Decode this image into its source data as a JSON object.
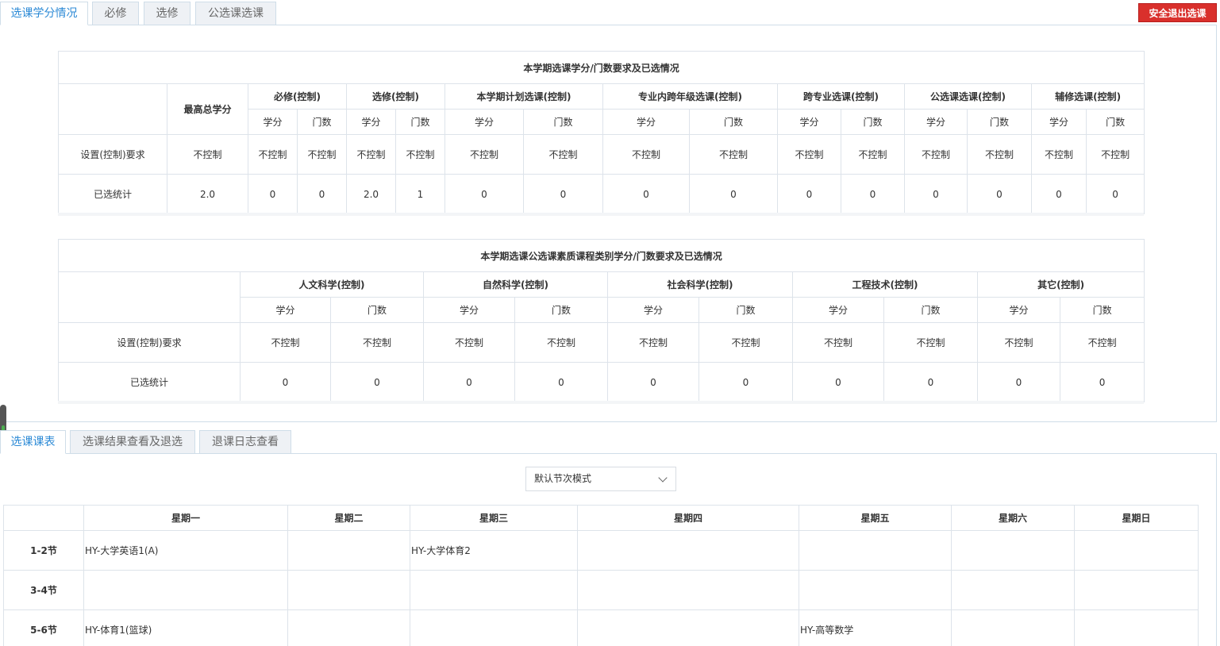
{
  "top_tabs": [
    "选课学分情况",
    "必修",
    "选修",
    "公选课选课"
  ],
  "exit_button": "安全退出选课",
  "credit_table": {
    "title": "本学期选课学分/门数要求及已选情况",
    "max_total_label": "最高总学分",
    "groups": [
      "必修(控制)",
      "选修(控制)",
      "本学期计划选课(控制)",
      "专业内跨年级选课(控制)",
      "跨专业选课(控制)",
      "公选课选课(控制)",
      "辅修选课(控制)"
    ],
    "sub_credit": "学分",
    "sub_count": "门数",
    "rows": [
      {
        "label": "设置(控制)要求",
        "max": "不控制",
        "values": [
          "不控制",
          "不控制",
          "不控制",
          "不控制",
          "不控制",
          "不控制",
          "不控制",
          "不控制",
          "不控制",
          "不控制",
          "不控制",
          "不控制",
          "不控制",
          "不控制"
        ]
      },
      {
        "label": "已选统计",
        "max": "2.0",
        "values": [
          "0",
          "0",
          "2.0",
          "1",
          "0",
          "0",
          "0",
          "0",
          "0",
          "0",
          "0",
          "0",
          "0",
          "0"
        ]
      }
    ]
  },
  "gen_table": {
    "title": "本学期选课公选课素质课程类别学分/门数要求及已选情况",
    "groups": [
      "人文科学(控制)",
      "自然科学(控制)",
      "社会科学(控制)",
      "工程技术(控制)",
      "其它(控制)"
    ],
    "sub_credit": "学分",
    "sub_count": "门数",
    "rows": [
      {
        "label": "设置(控制)要求",
        "values": [
          "不控制",
          "不控制",
          "不控制",
          "不控制",
          "不控制",
          "不控制",
          "不控制",
          "不控制",
          "不控制",
          "不控制"
        ]
      },
      {
        "label": "已选统计",
        "values": [
          "0",
          "0",
          "0",
          "0",
          "0",
          "0",
          "0",
          "0",
          "0",
          "0"
        ]
      }
    ]
  },
  "bottom_tabs": [
    "选课课表",
    "选课结果查看及退选",
    "退课日志查看"
  ],
  "mode_select": "默认节次模式",
  "timetable": {
    "days": [
      "星期一",
      "星期二",
      "星期三",
      "星期四",
      "星期五",
      "星期六",
      "星期日"
    ],
    "rows": [
      {
        "label": "1-2节",
        "cells": [
          "HY-大学英语1(A)",
          "",
          "HY-大学体育2",
          "",
          "",
          "",
          ""
        ]
      },
      {
        "label": "3-4节",
        "cells": [
          "",
          "",
          "",
          "",
          "",
          "",
          ""
        ]
      },
      {
        "label": "5-6节",
        "cells": [
          "HY-体育1(篮球)",
          "",
          "",
          "",
          "HY-高等数学",
          "",
          ""
        ]
      }
    ]
  }
}
